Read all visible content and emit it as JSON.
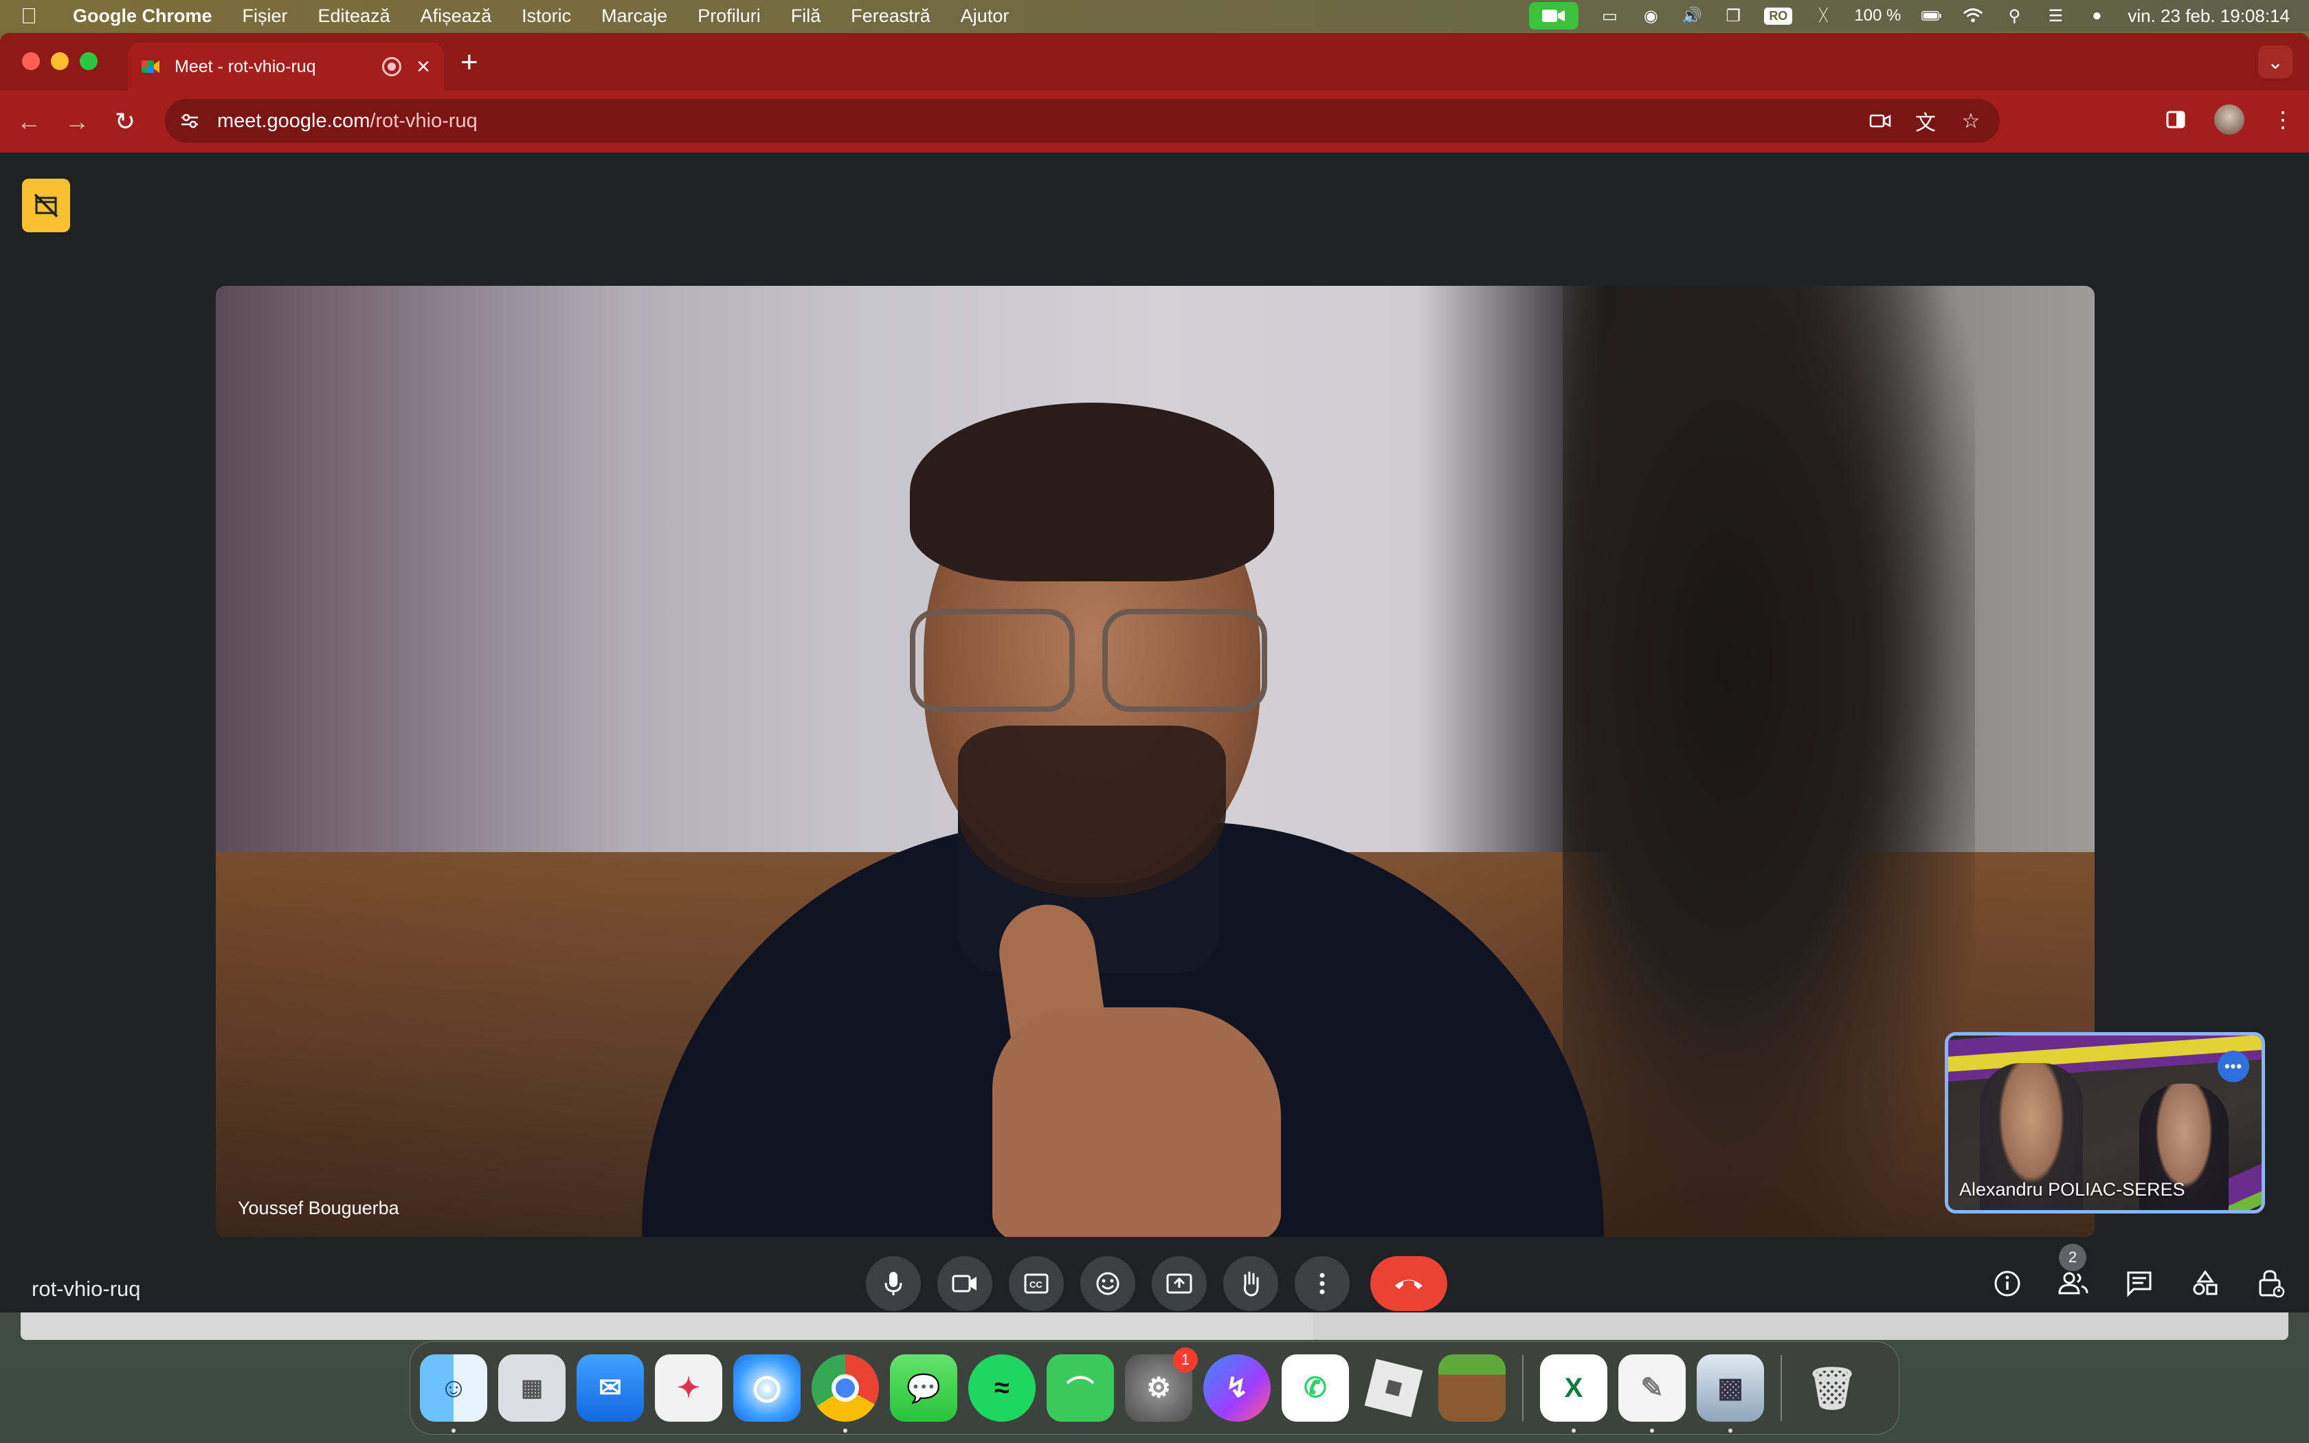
{
  "menubar": {
    "app_name": "Google Chrome",
    "items": [
      "Fișier",
      "Editează",
      "Afișează",
      "Istoric",
      "Marcaje",
      "Profiluri",
      "Filă",
      "Fereastră",
      "Ajutor"
    ],
    "keyboard_layout": "RO",
    "battery": "100 %",
    "datetime": "vin. 23 feb.  19:08:14"
  },
  "browser": {
    "tab_title": "Meet - rot-vhio-ruq",
    "url_host": "meet.google.com",
    "url_path": "/rot-vhio-ruq"
  },
  "meet": {
    "main_participant": "Youssef Bouguerba",
    "self_participant": "Alexandru POLIAC-SERES",
    "meeting_code": "rot-vhio-ruq",
    "participant_count": "2"
  },
  "dock": {
    "badge_settings": "1"
  },
  "colors": {
    "chrome_theme": "#a31e1c",
    "end_call": "#ea4335",
    "notice_yellow": "#f9c132",
    "self_tile_border": "#8ab4f8"
  }
}
